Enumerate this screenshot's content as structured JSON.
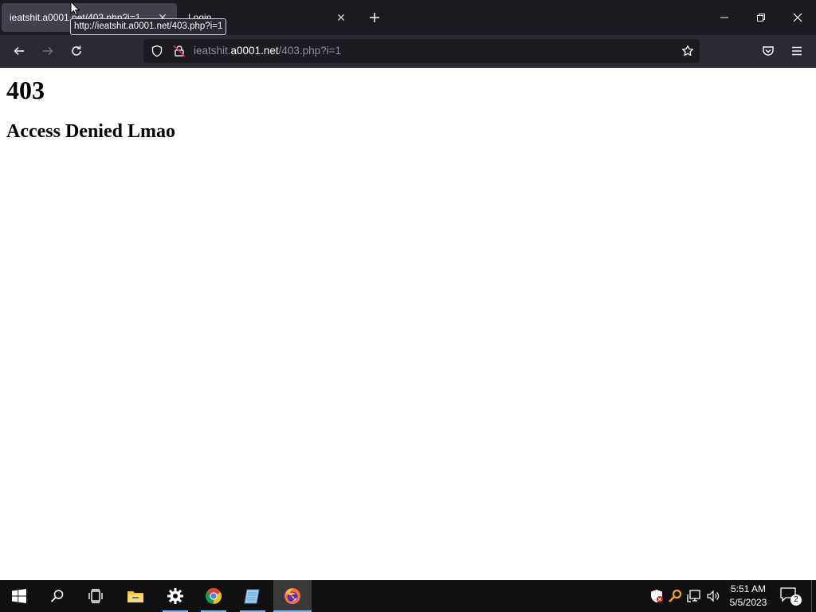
{
  "browser": {
    "tabs": [
      {
        "title": "ieatshit.a0001.net/403.php?i=1",
        "active": true
      },
      {
        "title": "Login",
        "active": false
      }
    ],
    "tooltip": "http://ieatshit.a0001.net/403.php?i=1",
    "url": {
      "prefix": "ieatshit.",
      "host": "a0001.net",
      "path": "/403.php?i=1"
    },
    "icons": {
      "back": "back-arrow-icon",
      "forward": "forward-arrow-icon",
      "reload": "reload-icon",
      "tracking": "shield-icon",
      "lock": "insecure-lock-icon",
      "bookmark": "star-icon",
      "pocket": "pocket-icon",
      "menu": "hamburger-menu-icon"
    }
  },
  "page": {
    "heading": "403",
    "subheading": "Access Denied Lmao"
  },
  "taskbar": {
    "apps": [
      "start",
      "search",
      "task-view",
      "file-explorer",
      "settings",
      "chrome",
      "notepad",
      "firefox"
    ],
    "clock": {
      "time": "5:51 AM",
      "date": "5/5/2023"
    },
    "notification_count": "2"
  },
  "colors": {
    "tab_active": "#42414d",
    "toolbar": "#2b2a33",
    "urlbar": "#1c1b22",
    "taskbar": "#101010",
    "taskbar_indicator": "#76b9ed"
  }
}
